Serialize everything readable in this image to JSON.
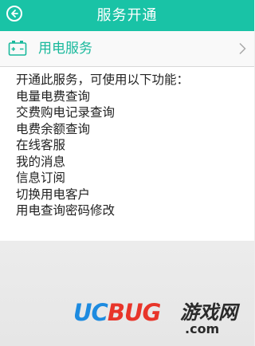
{
  "header": {
    "title": "服务开通",
    "back_icon": "back-arrow-circle-icon"
  },
  "service": {
    "label": "用电服务",
    "icon": "battery-icon",
    "chevron": "chevron-right-icon"
  },
  "content": {
    "intro": "开通此服务，可使用以下功能：",
    "features": [
      "电量电费查询",
      "交费购电记录查询",
      "电费余额查询",
      "在线客服",
      "我的消息",
      "信息订阅",
      "切换用电客户",
      "用电查询密码修改"
    ]
  },
  "watermark": {
    "part1": "UC",
    "part2": "BUG",
    "cn": "游戏网",
    "domain": ".com"
  },
  "colors": {
    "header_bg": "#19c3a6",
    "accent_text": "#19b99c"
  }
}
